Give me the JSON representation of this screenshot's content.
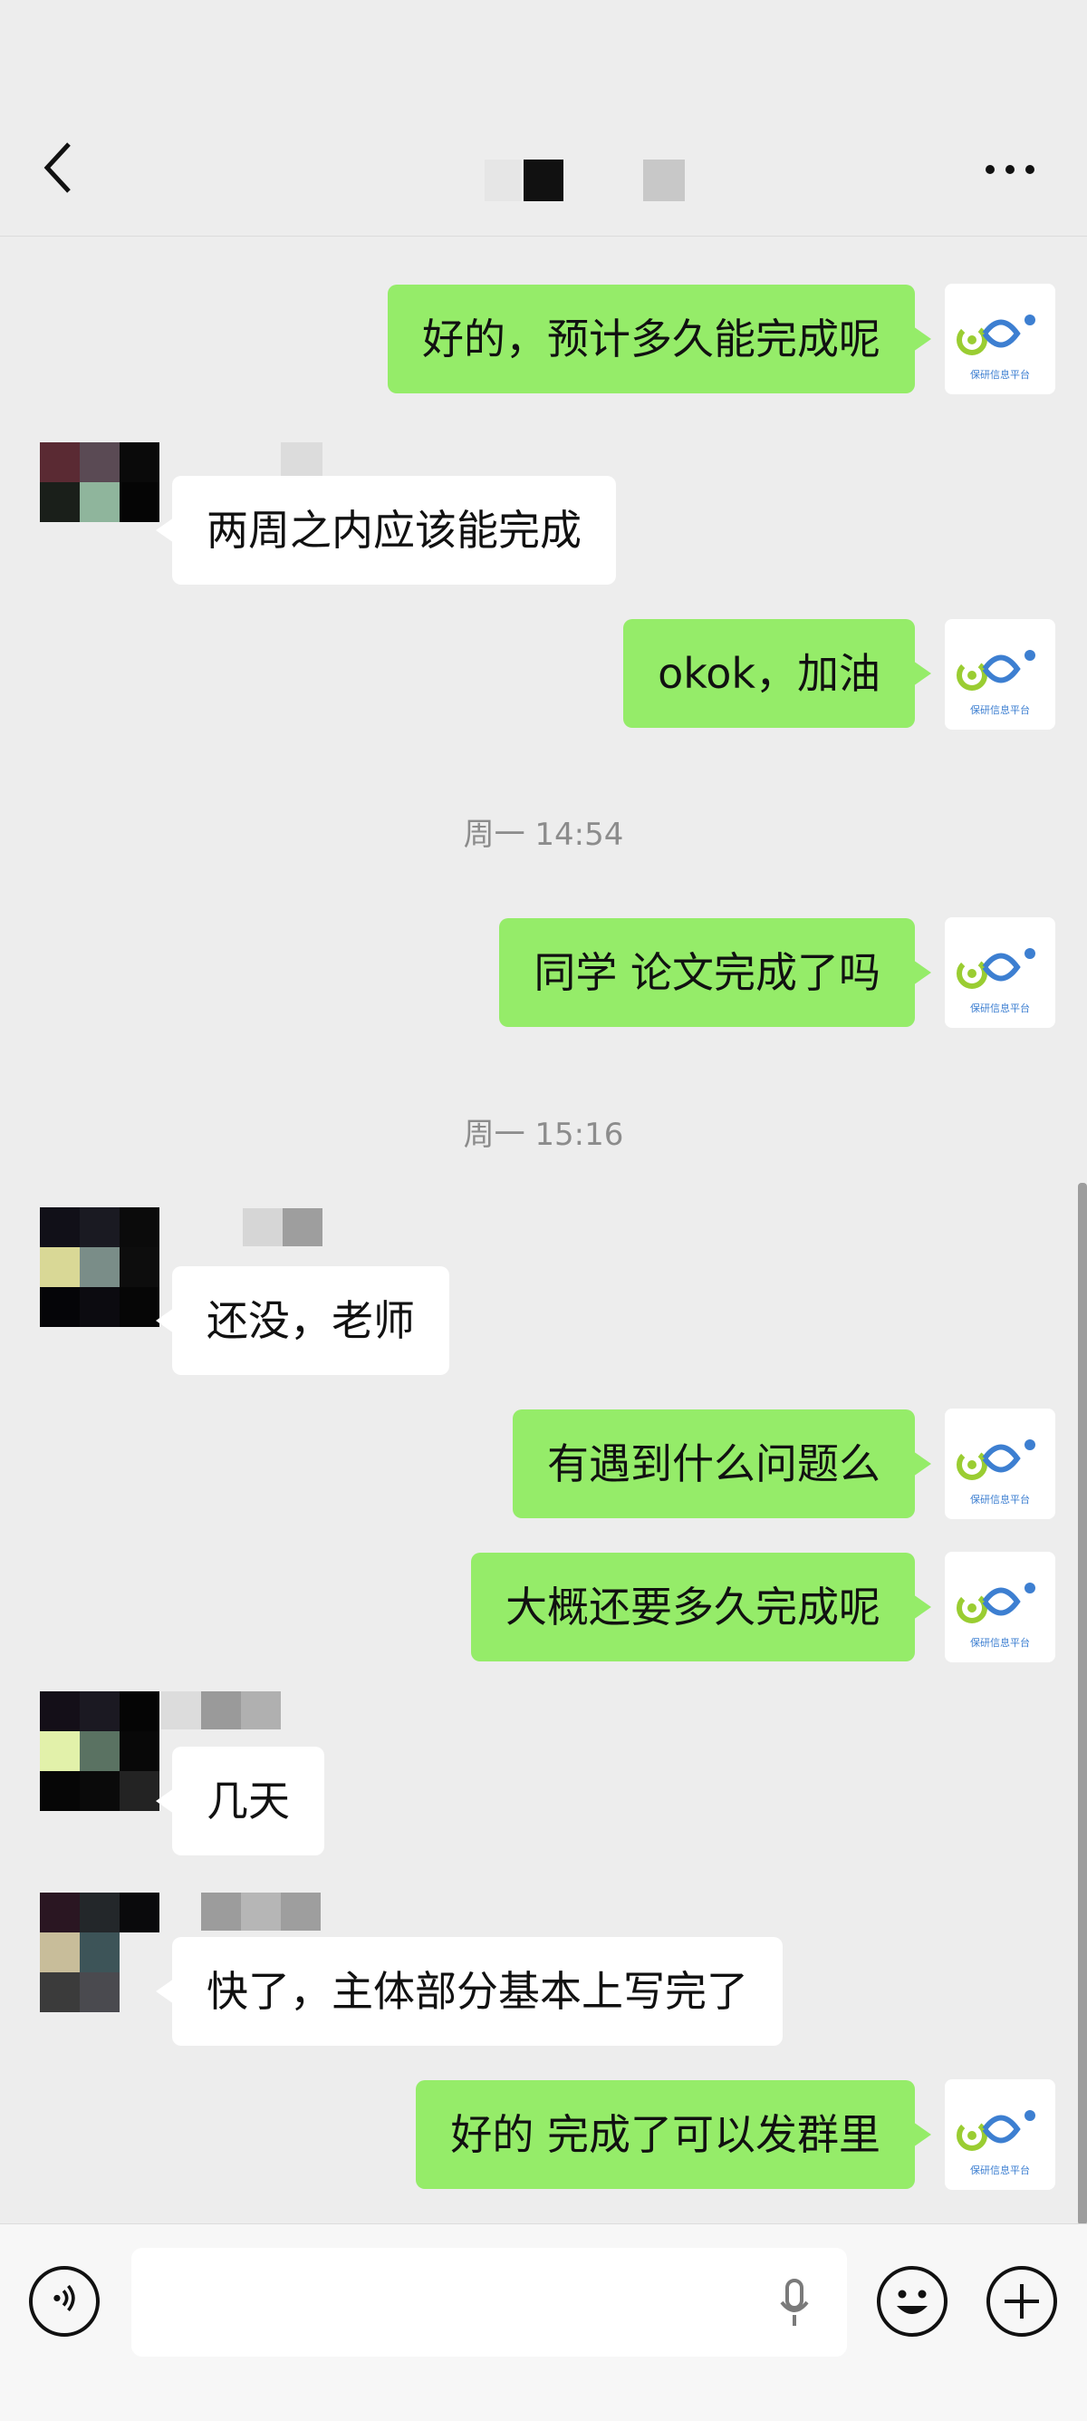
{
  "header": {
    "back_icon": "chevron-left-icon",
    "more_icon": "more-dots-icon"
  },
  "messages": [
    {
      "from": "me",
      "text": "好的，预计多久能完成呢"
    },
    {
      "from": "them",
      "text": "两周之内应该能完成"
    },
    {
      "from": "me",
      "text": "okok，加油"
    },
    {
      "type": "time",
      "text": "周一 14:54"
    },
    {
      "from": "me",
      "text": "同学 论文完成了吗"
    },
    {
      "type": "time",
      "text": "周一 15:16"
    },
    {
      "from": "them",
      "text": "还没，老师"
    },
    {
      "from": "me",
      "text": "有遇到什么问题么"
    },
    {
      "from": "me",
      "text": "大概还要多久完成呢"
    },
    {
      "from": "them",
      "text": "几天"
    },
    {
      "from": "them",
      "text": "快了，主体部分基本上写完了"
    },
    {
      "from": "me",
      "text": "好的 完成了可以发群里"
    }
  ],
  "avatar_me_caption": "保研信息平台",
  "colors": {
    "me_bubble": "#95ec69",
    "them_bubble": "#ffffff",
    "background": "#ededed",
    "logo_green": "#9acd32",
    "logo_blue": "#3d7fd1"
  },
  "input_bar": {
    "voice_icon": "voice-toggle-icon",
    "mic_icon": "microphone-icon",
    "emoji_icon": "emoji-icon",
    "plus_icon": "plus-icon"
  }
}
